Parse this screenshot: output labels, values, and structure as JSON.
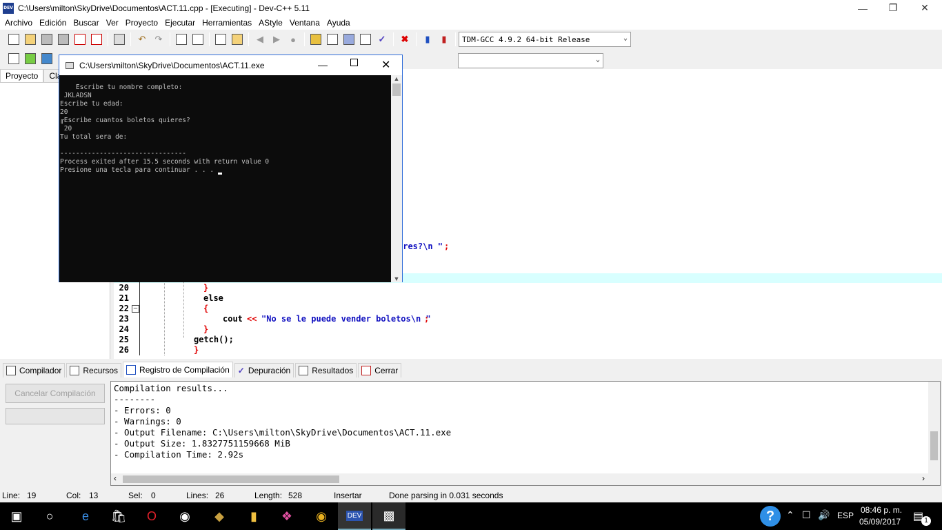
{
  "window": {
    "title": "C:\\Users\\milton\\SkyDrive\\Documentos\\ACT.11.cpp - [Executing] - Dev-C++ 5.11",
    "icon_text": "DEV"
  },
  "menu": [
    "Archivo",
    "Edición",
    "Buscar",
    "Ver",
    "Proyecto",
    "Ejecutar",
    "Herramientas",
    "AStyle",
    "Ventana",
    "Ayuda"
  ],
  "toolbar": {
    "compiler_select": "TDM-GCC 4.9.2 64-bit Release"
  },
  "left_panel": {
    "tabs": [
      "Proyecto",
      "Cla"
    ]
  },
  "editor": {
    "lines": [
      {
        "num": "20",
        "code": "}",
        "color": "red",
        "indent": 130
      },
      {
        "num": "21",
        "code": "else",
        "color": "dk",
        "indent": 130
      },
      {
        "num": "22",
        "code": "{",
        "color": "red",
        "indent": 130
      },
      {
        "num": "23",
        "code": "cout",
        "color": "dk",
        "indent": 158
      },
      {
        "num": "24",
        "code": "}",
        "color": "red",
        "indent": 130
      },
      {
        "num": "25",
        "code": "getch();",
        "color": "dk",
        "indent": 116
      },
      {
        "num": "26",
        "code": "}",
        "color": "red",
        "indent": 116
      }
    ],
    "line23_op": "<<",
    "line23_str": "\"No se le puede vender boletos\\n \"",
    "line23_end": ";",
    "partial_visible": "eres?\\n \"",
    "partial_end": ";"
  },
  "console": {
    "title": "C:\\Users\\milton\\SkyDrive\\Documentos\\ACT.11.exe",
    "output": "Escribe tu nombre completo:\n JKLADSN\nEscribe tu edad:\n20\n╓Escribe cuantos boletos quieres?\n 20\nTu total sera de:\n\n--------------------------------\nProcess exited after 15.5 seconds with return value 0\nPresione una tecla para continuar . . . "
  },
  "bottom_tabs": [
    "Compilador",
    "Recursos",
    "Registro de Compilación",
    "Depuración",
    "Resultados",
    "Cerrar"
  ],
  "compile_panel": {
    "cancel_button": "Cancelar Compilación",
    "results": "Compilation results...\n--------\n- Errors: 0\n- Warnings: 0\n- Output Filename: C:\\Users\\milton\\SkyDrive\\Documentos\\ACT.11.exe\n- Output Size: 1.8327751159668 MiB\n- Compilation Time: 2.92s"
  },
  "status": {
    "line_label": "Line:",
    "line_value": "19",
    "col_label": "Col:",
    "col_value": "13",
    "sel_label": "Sel:",
    "sel_value": "0",
    "lines_label": "Lines:",
    "lines_value": "26",
    "length_label": "Length:",
    "length_value": "528",
    "mode": "Insertar",
    "message": "Done parsing in 0.031 seconds"
  },
  "taskbar": {
    "language": "ESP",
    "time": "08:46 p. m.",
    "date": "05/09/2017",
    "notification_count": "1"
  }
}
